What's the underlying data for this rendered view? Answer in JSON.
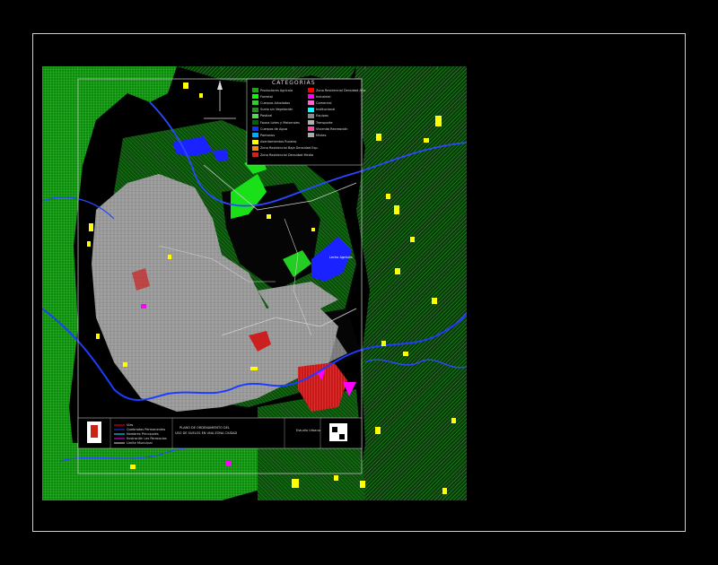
{
  "legend": {
    "title": "CATEGORIAS",
    "items": [
      {
        "label": "Productores Agrícola",
        "color": "#1aa31a"
      },
      {
        "label": "Forestal",
        "color": "#00ff00"
      },
      {
        "label": "Cuerpos Arbolados",
        "color": "#33cc33"
      },
      {
        "label": "Suelo sin Vegetación",
        "color": "#2a8a2a"
      },
      {
        "label": "Pastizal",
        "color": "#4fdc4f"
      },
      {
        "label": "Fauna Lotes y Matorrales",
        "color": "#0a5c0a"
      },
      {
        "label": "Cuerpos de Agua",
        "color": "#1030ff"
      },
      {
        "label": "Pantanos",
        "color": "#00aaff"
      },
      {
        "label": "Asentamientos Rurales",
        "color": "#ffff00"
      },
      {
        "label": "Zona Residencial Baja Densidad Esp.",
        "color": "#ff8800"
      },
      {
        "label": "Zona Residencial Densidad Media",
        "color": "#cc2222"
      },
      {
        "label": "Zona Residencial Densidad Alta",
        "color": "#ff0000"
      },
      {
        "label": "Industrial",
        "color": "#ff00ff"
      },
      {
        "label": "Comercial",
        "color": "#ff66cc"
      },
      {
        "label": "Institucional",
        "color": "#00ffff"
      },
      {
        "label": "Equipos",
        "color": "#888888"
      },
      {
        "label": "Transporte",
        "color": "#b0b0b0"
      },
      {
        "label": "Vivienda Recreación",
        "color": "#ff44aa"
      },
      {
        "label": "Mixtas",
        "color": "#aaaaaa"
      }
    ]
  },
  "map": {
    "place_label": "Lecho Agrícola",
    "north_label": "N"
  },
  "title_block": {
    "title_line1": "PLANO DE ORDENAMIENTO DEL",
    "title_line2": "USO DE SUELOS EN UNA ZONA CIUDAD",
    "legend_lines": [
      "Vías",
      "Quebradas Permanentes",
      "Nombres Principales",
      "Ilustración Les Parroquias",
      "Límite Municipal"
    ],
    "box_label": "Estudio Urbano"
  }
}
